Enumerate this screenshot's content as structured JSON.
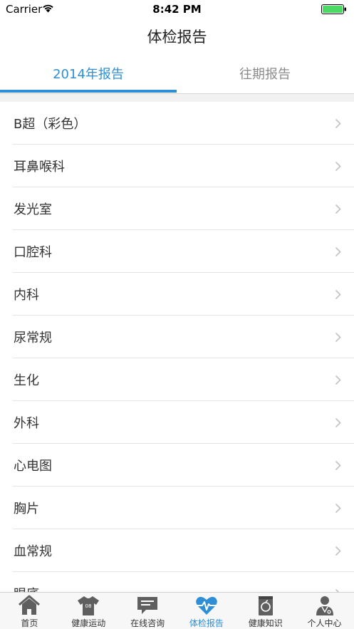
{
  "status_bar": {
    "carrier": "Carrier",
    "time": "8:42 PM"
  },
  "nav": {
    "title": "体检报告"
  },
  "tabs": [
    {
      "label": "2014年报告",
      "active": true
    },
    {
      "label": "往期报告",
      "active": false
    }
  ],
  "list": {
    "items": [
      {
        "label": "B超（彩色）"
      },
      {
        "label": "耳鼻喉科"
      },
      {
        "label": "发光室"
      },
      {
        "label": "口腔科"
      },
      {
        "label": "内科"
      },
      {
        "label": "尿常规"
      },
      {
        "label": "生化"
      },
      {
        "label": "外科"
      },
      {
        "label": "心电图"
      },
      {
        "label": "胸片"
      },
      {
        "label": "血常规"
      },
      {
        "label": "眼底"
      }
    ]
  },
  "tabbar": {
    "items": [
      {
        "label": "首页",
        "icon": "home-icon"
      },
      {
        "label": "健康运动",
        "icon": "jersey-icon",
        "badge": "08"
      },
      {
        "label": "在线咨询",
        "icon": "chat-icon"
      },
      {
        "label": "体检报告",
        "icon": "heartbeat-icon",
        "active": true
      },
      {
        "label": "健康知识",
        "icon": "apple-book-icon"
      },
      {
        "label": "个人中心",
        "icon": "doctor-icon"
      }
    ]
  },
  "colors": {
    "accent": "#2e8fd6",
    "battery": "#4cd964",
    "icon_gray": "#5f5f5f"
  }
}
